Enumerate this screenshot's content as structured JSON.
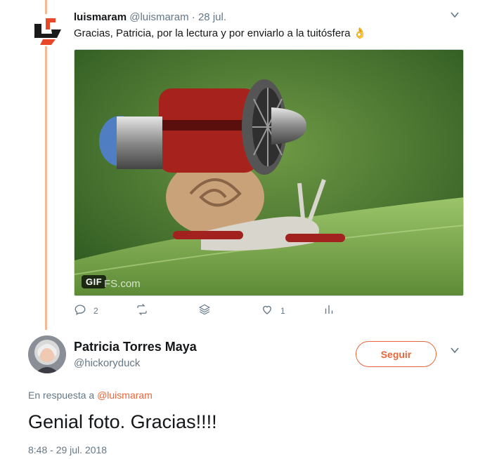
{
  "colors": {
    "accent": "#e8663a",
    "thread_line": "#f6b893",
    "secondary_text": "#657786",
    "primary_text": "#14171a"
  },
  "tweet1": {
    "name": "luismaram",
    "handle": "@luismaram",
    "separator": "·",
    "date": "28 jul.",
    "text": "Gracias, Patricia, por la lectura y por enviarlo a la tuitósfera",
    "emoji": "👌",
    "media": {
      "badge": "GIF",
      "watermark": "FS.com"
    },
    "actions": {
      "reply_icon": "reply-icon",
      "reply_count": "2",
      "retweet_icon": "retweet-icon",
      "retweet_count": "",
      "layers_icon": "layers-icon",
      "like_icon": "heart-icon",
      "like_count": "1",
      "analytics_icon": "analytics-icon"
    }
  },
  "tweet2": {
    "name": "Patricia Torres Maya",
    "handle": "@hickoryduck",
    "follow_label": "Seguir",
    "reply_prefix": "En respuesta a",
    "reply_mention": "@luismaram",
    "text": "Genial foto. Gracias!!!!",
    "timestamp": "8:48 - 29 jul. 2018"
  }
}
